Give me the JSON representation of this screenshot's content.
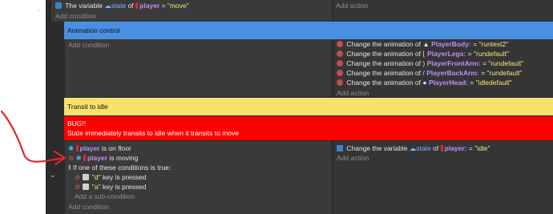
{
  "colors": {
    "comment_blue": "#4a90e2",
    "comment_yellow": "#f7e26b",
    "comment_red": "#ff0000",
    "arrow_red": "#e0262e"
  },
  "top_event": {
    "condition": {
      "prefix": "The variable",
      "var": "state",
      "of": "of",
      "object": "player",
      "eq": "=",
      "value": "\"move\""
    },
    "add_condition": "Add condition",
    "add_action": "Add action"
  },
  "comment_animation": "Animation control",
  "anim_event": {
    "add_condition": "Add condition",
    "actions": [
      {
        "text": "Change the animation of",
        "object": "PlayerBody:",
        "eq": "=",
        "value": "\"runtest2\""
      },
      {
        "text": "Change the animation of",
        "object": "PlayerLegs:",
        "eq": "=",
        "value": "\"rundefault\""
      },
      {
        "text": "Change the animation of",
        "object": "PlayerFrontArm:",
        "eq": "=",
        "value": "\"rundefault\""
      },
      {
        "text": "Change the animation of",
        "object": "PlayerBackArm:",
        "eq": "=",
        "value": "\"rundefault\""
      },
      {
        "text": "Change the animation of",
        "object": "PlayerHead:",
        "eq": "=",
        "value": "\"idledefault\""
      }
    ],
    "add_action": "Add action"
  },
  "comment_transit": "Transit to idle",
  "comment_bug": {
    "line1": "BUG!!",
    "line2": "State immediately transits to idle when it transits to move"
  },
  "idle_event": {
    "conditions": [
      {
        "object": "player",
        "text": "is on floor"
      },
      {
        "object": "player",
        "text": "is moving"
      }
    ],
    "or_text": "If one of these conditions is true:",
    "keys": [
      {
        "key": "\"d\"",
        "text": "key is pressed"
      },
      {
        "key": "\"a\"",
        "text": "key is pressed"
      }
    ],
    "add_subcondition": "Add a sub-condition",
    "add_condition": "Add condition",
    "action": {
      "prefix": "Change the variable",
      "var": "state",
      "of": "of",
      "object": "player:",
      "eq": "=",
      "value": "\"idle\""
    },
    "add_action": "Add action"
  }
}
